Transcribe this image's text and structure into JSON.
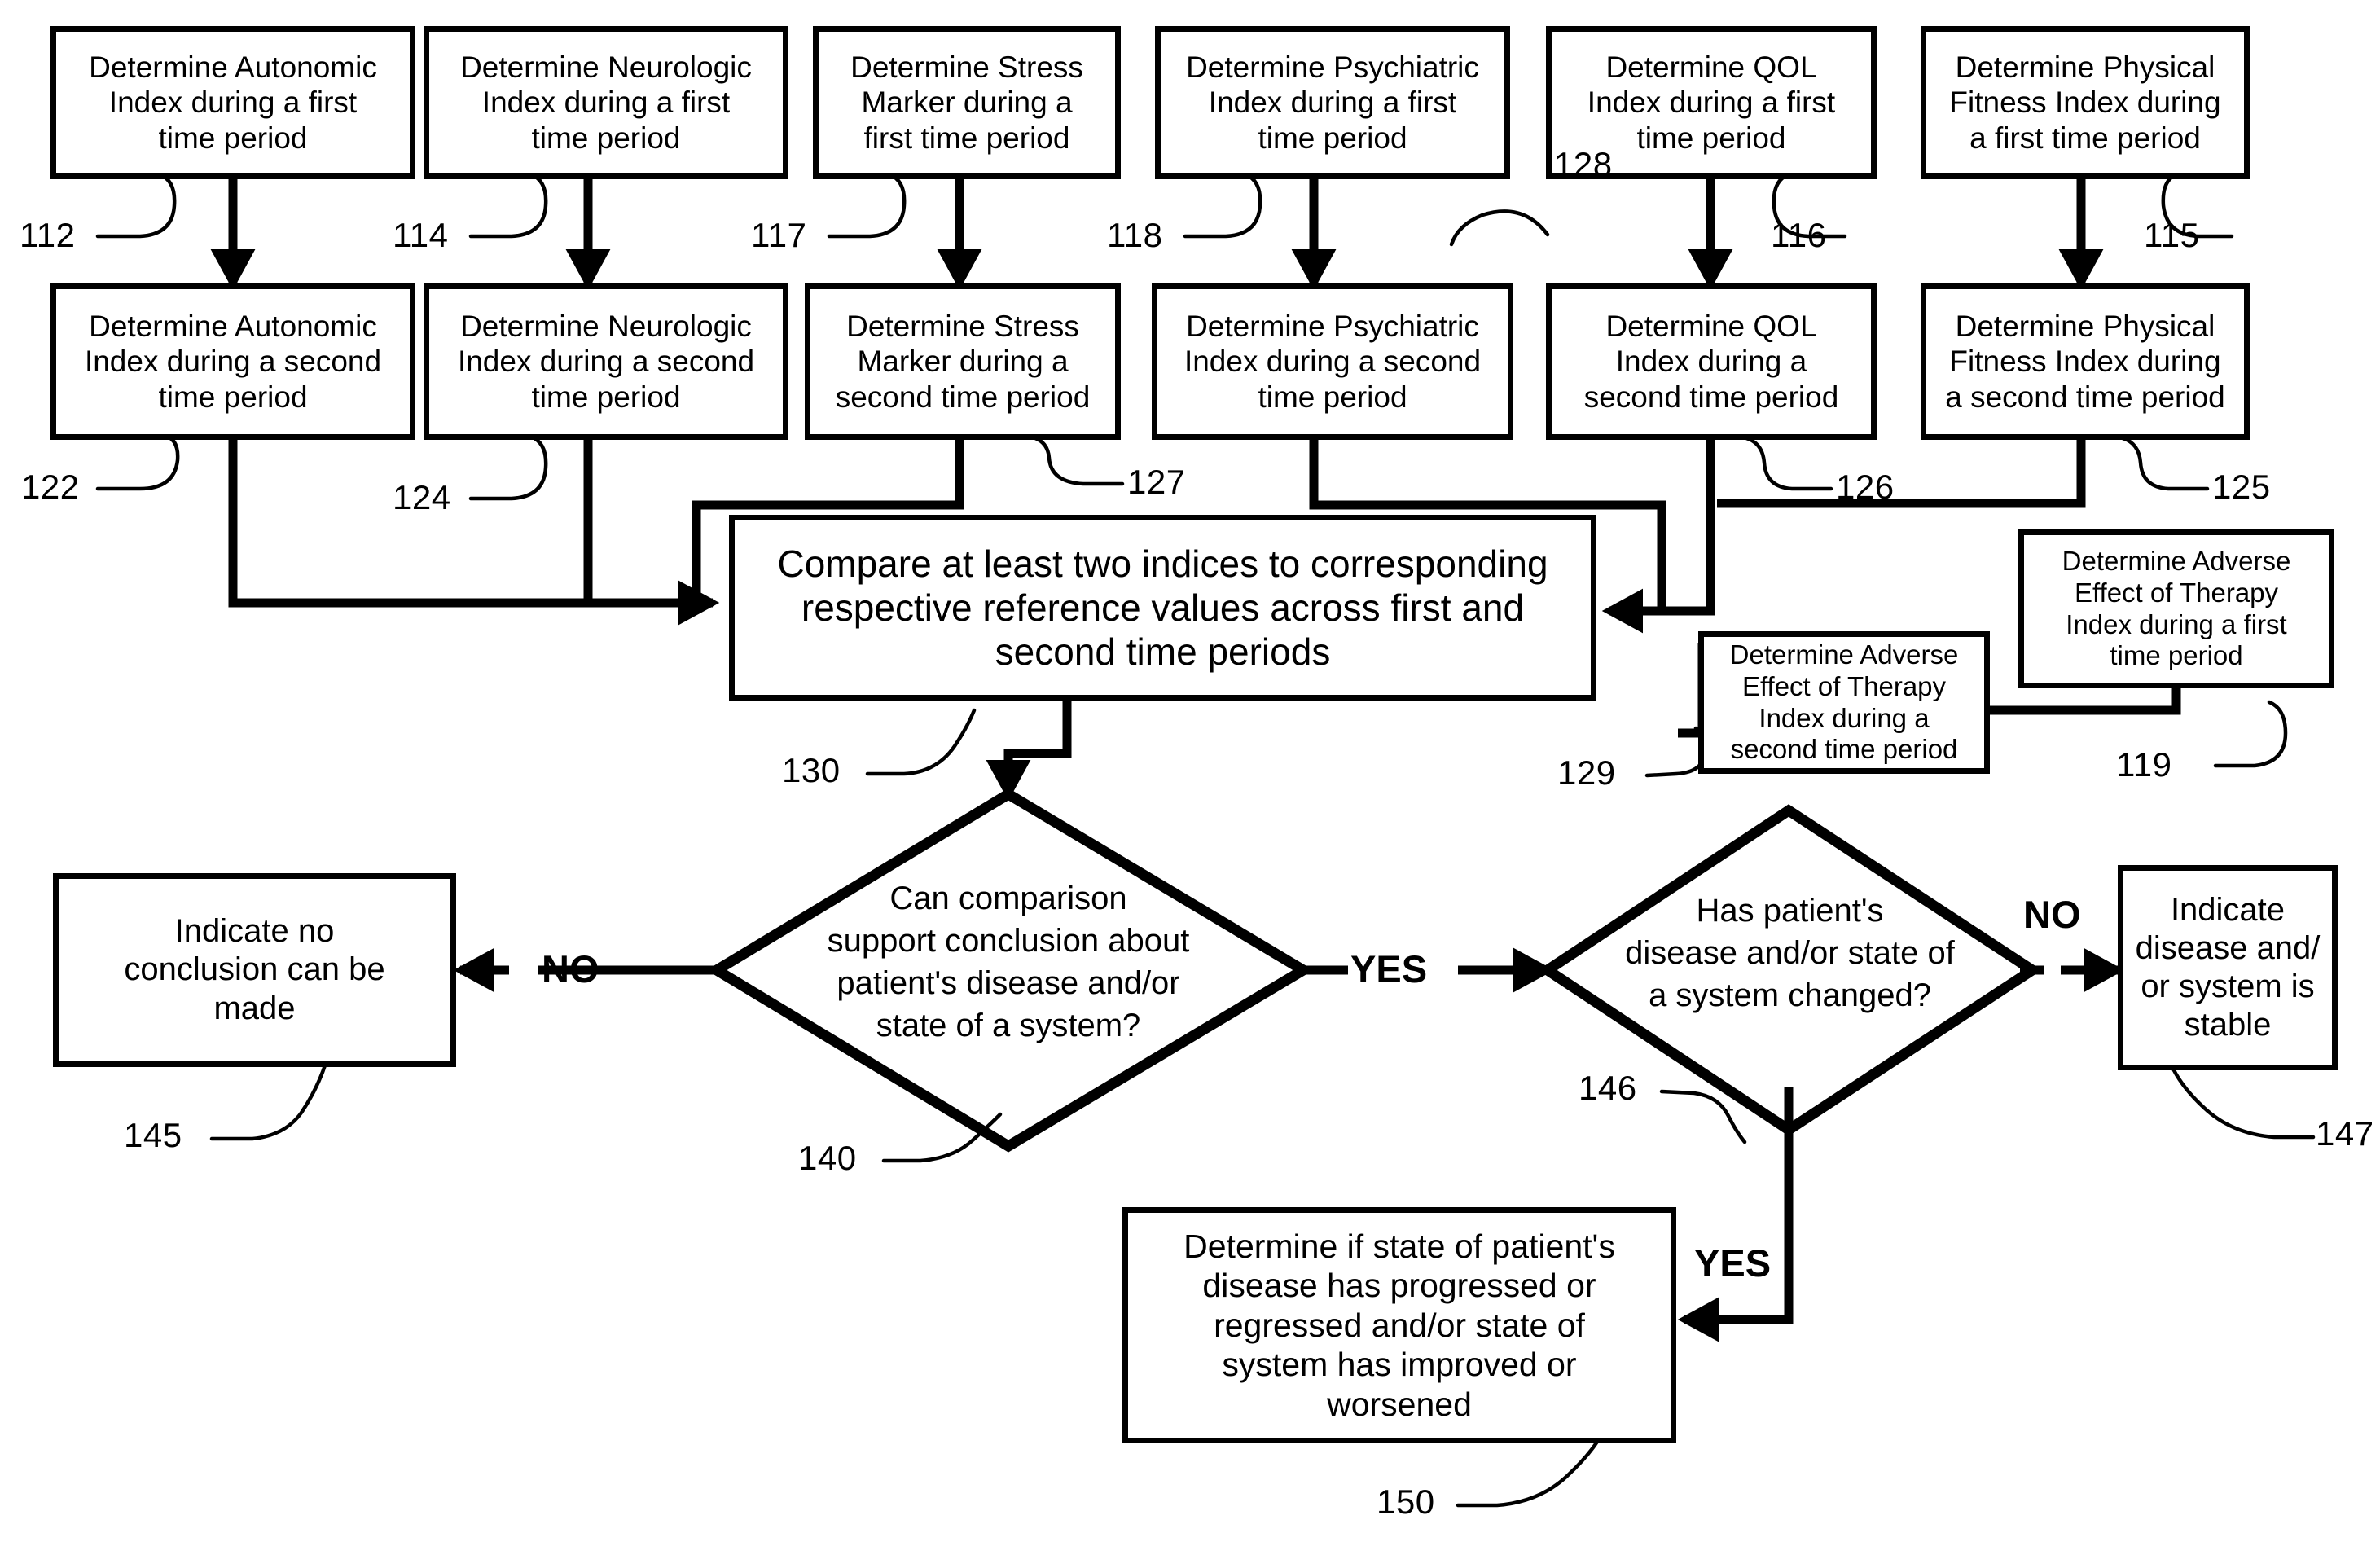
{
  "figure": {
    "type": "patent-flowchart",
    "background": "#ffffff",
    "stroke": "#000000"
  },
  "nodes": {
    "autonomic_first": "Determine Autonomic\nIndex during a first\ntime period",
    "neurologic_first": "Determine Neurologic\nIndex during a first\ntime period",
    "stress_first": "Determine Stress\nMarker during a\nfirst time period",
    "psychiatric_first": "Determine Psychiatric\nIndex during a first\ntime period",
    "qol_first": "Determine QOL\nIndex during a first\ntime period",
    "fitness_first": "Determine Physical\nFitness Index during\na first time period",
    "autonomic_second": "Determine Autonomic\nIndex during a second\ntime period",
    "neurologic_second": "Determine Neurologic\nIndex during a second\ntime period",
    "stress_second": "Determine Stress\nMarker during a\nsecond time period",
    "psychiatric_second": "Determine Psychiatric\nIndex during a second\ntime period",
    "qol_second": "Determine QOL\nIndex during a\nsecond time period",
    "fitness_second": "Determine Physical\nFitness Index during\na second time period",
    "adverse_first": "Determine Adverse\nEffect of Therapy\nIndex during a first\ntime period",
    "adverse_second": "Determine Adverse\nEffect of Therapy\nIndex during a\nsecond time period",
    "compare": "Compare at least two indices to corresponding\nrespective reference values across first and\nsecond time periods",
    "decision_conclusion": "Can comparison\nsupport conclusion about\npatient's disease and/or\nstate of a system?",
    "decision_changed": "Has patient's\ndisease and/or state of\na system changed?",
    "no_conclusion": "Indicate no\nconclusion can be\nmade",
    "stable": "Indicate\ndisease and/\nor system is\nstable",
    "progressed": "Determine if state of patient's\ndisease has progressed or\nregressed and/or state of\nsystem has improved or\nworsened"
  },
  "reference_numerals": {
    "n112": "112",
    "n114": "114",
    "n117": "117",
    "n118": "118",
    "n116": "116",
    "n115": "115",
    "n122": "122",
    "n124": "124",
    "n127": "127",
    "n128": "128",
    "n126": "126",
    "n125": "125",
    "n119": "119",
    "n129": "129",
    "n130": "130",
    "n140": "140",
    "n145": "145",
    "n146": "146",
    "n147": "147",
    "n150": "150"
  },
  "branch_labels": {
    "no_left": "NO",
    "yes_center": "YES",
    "no_right": "NO",
    "yes_down": "YES"
  }
}
